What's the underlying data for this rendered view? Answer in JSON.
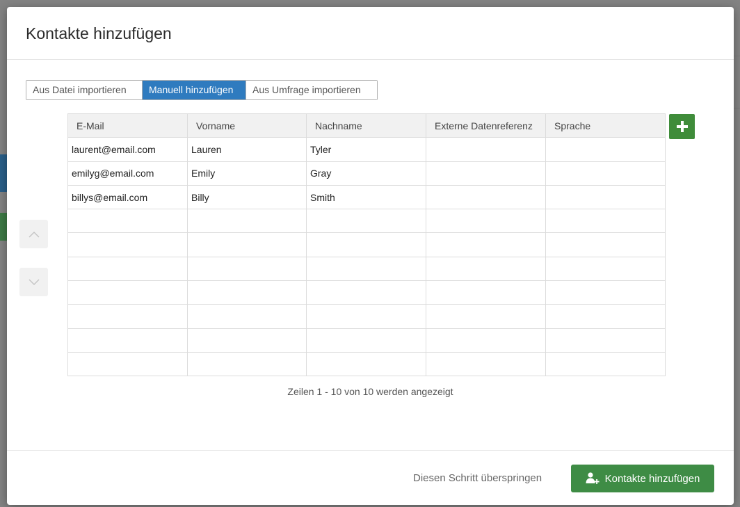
{
  "modal": {
    "title": "Kontakte hinzufügen"
  },
  "tabs": [
    {
      "label": "Aus Datei importieren",
      "active": false
    },
    {
      "label": "Manuell hinzufügen",
      "active": true
    },
    {
      "label": "Aus Umfrage importieren",
      "active": false
    }
  ],
  "table": {
    "columns": [
      "E-Mail",
      "Vorname",
      "Nachname",
      "Externe Datenreferenz",
      "Sprache"
    ],
    "rows": [
      [
        "laurent@email.com",
        "Lauren",
        "Tyler",
        "",
        ""
      ],
      [
        "emilyg@email.com",
        "Emily",
        "Gray",
        "",
        ""
      ],
      [
        "billys@email.com",
        "Billy",
        "Smith",
        "",
        ""
      ],
      [
        "",
        "",
        "",
        "",
        ""
      ],
      [
        "",
        "",
        "",
        "",
        ""
      ],
      [
        "",
        "",
        "",
        "",
        ""
      ],
      [
        "",
        "",
        "",
        "",
        ""
      ],
      [
        "",
        "",
        "",
        "",
        ""
      ],
      [
        "",
        "",
        "",
        "",
        ""
      ],
      [
        "",
        "",
        "",
        "",
        ""
      ]
    ]
  },
  "status": "Zeilen 1 - 10 von 10 werden angezeigt",
  "footer": {
    "skip_label": "Diesen Schritt überspringen",
    "submit_label": "Kontakte hinzufügen"
  },
  "colors": {
    "accent_blue": "#2f7bbf",
    "success_green": "#3e8c45"
  },
  "icons": {
    "add_column": "plus-icon",
    "move_up": "chevron-up-icon",
    "move_down": "chevron-down-icon",
    "submit": "add-user-icon"
  }
}
